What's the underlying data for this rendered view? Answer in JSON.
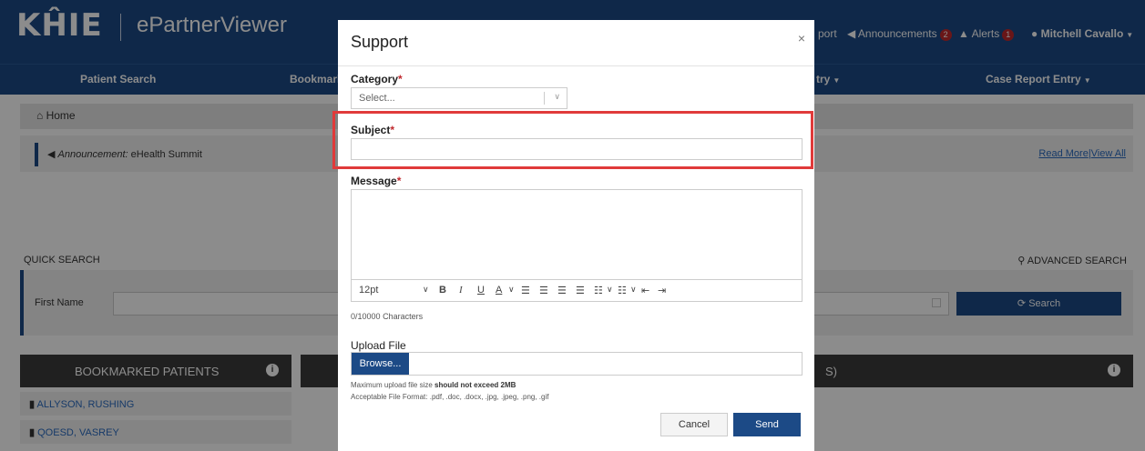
{
  "header": {
    "logo": "KĤIE",
    "app_name": "ePartnerViewer",
    "support_link": "port",
    "announcements_label": "Announcements",
    "announcements_count": "2",
    "alerts_label": "Alerts",
    "alerts_count": "1",
    "user_name": "Mitchell Cavallo"
  },
  "nav": {
    "patient_search": "Patient Search",
    "bookmarks": "Bookmark",
    "entry": "try",
    "case_report": "Case Report Entry"
  },
  "breadcrumb": {
    "home": "Home"
  },
  "announcement": {
    "label": "Announcement:",
    "text": "eHealth Summit",
    "read_more": "Read More",
    "separator": "|",
    "view_all": "View All"
  },
  "quick_search": {
    "label": "QUICK SEARCH",
    "advanced": "ADVANCED SEARCH",
    "first_name": "First Name",
    "search_button": "Search"
  },
  "bookmarks": {
    "title": "BOOKMARKED PATIENTS",
    "items": [
      "ALLYSON, RUSHING",
      "QOESD, VASREY"
    ]
  },
  "right_panel": {
    "title_fragment": "S)"
  },
  "modal": {
    "title": "Support",
    "close": "×",
    "category_label": "Category",
    "category_placeholder": "Select...",
    "subject_label": "Subject",
    "message_label": "Message",
    "required_mark": "*",
    "font_size": "12pt",
    "char_count": "0/10000",
    "char_suffix": "Characters",
    "upload_label": "Upload File",
    "browse_label": "Browse...",
    "note_size_prefix": "Maximum upload file size",
    "note_size_bold": "should not exceed 2MB",
    "note_formats_prefix": "Acceptable File Format:",
    "note_formats": ".pdf, .doc, .docx, .jpg, .jpeg, .png, .gif",
    "cancel": "Cancel",
    "send": "Send"
  },
  "colors": {
    "brand_blue": "#1c4a86",
    "required_red": "#c0282d",
    "highlight_red": "#e03a3a",
    "dark_panel": "#3b3b3b"
  }
}
